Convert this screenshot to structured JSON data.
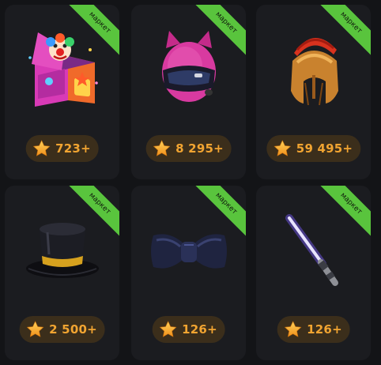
{
  "colors": {
    "background": "#131417",
    "card": "#1b1c20",
    "ribbon": "#59c43d",
    "price_text": "#f1a431",
    "star": "#f4a728"
  },
  "items": [
    {
      "badge": "маркет",
      "icon": "jack-in-the-box-icon",
      "price": "723+"
    },
    {
      "badge": "маркет",
      "icon": "pink-helmet-icon",
      "price": "8 295+"
    },
    {
      "badge": "маркет",
      "icon": "spartan-helmet-icon",
      "price": "59 495+"
    },
    {
      "badge": "маркет",
      "icon": "top-hat-icon",
      "price": "2 500+"
    },
    {
      "badge": "маркет",
      "icon": "bow-tie-icon",
      "price": "126+"
    },
    {
      "badge": "маркет",
      "icon": "lightsaber-icon",
      "price": "126+"
    }
  ]
}
